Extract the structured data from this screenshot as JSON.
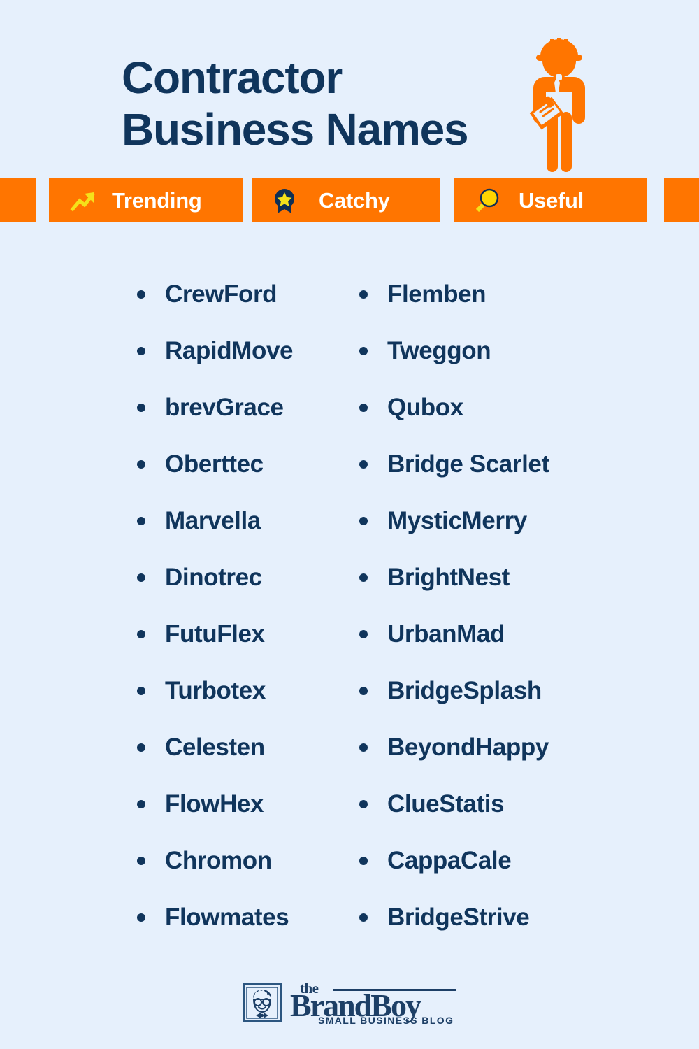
{
  "page": {
    "background_color": "#e6f0fc",
    "accent_color": "#ff7500",
    "navy_color": "#10355c",
    "yellow_color": "#f5e11a"
  },
  "header": {
    "title_line_1": "Contractor",
    "title_line_2": "Business Names",
    "illustration": "contractor-figure-icon"
  },
  "badge_bar": {
    "badges": [
      {
        "label": "Trending",
        "icon": "trending-up-arrow-icon"
      },
      {
        "label": "Catchy",
        "icon": "award-ribbon-star-icon"
      },
      {
        "label": "Useful",
        "icon": "magnifying-glass-icon"
      }
    ]
  },
  "names": {
    "left_column": [
      "CrewFord",
      "RapidMove",
      "brevGrace",
      "Oberttec",
      "Marvella",
      "Dinotrec",
      "FutuFlex",
      "Turbotex",
      "Celesten",
      "FlowHex",
      "Chromon",
      "Flowmates"
    ],
    "right_column": [
      "Flemben",
      "Tweggon",
      "Qubox",
      "Bridge Scarlet",
      "MysticMerry",
      "BrightNest",
      "UrbanMad",
      "BridgeSplash",
      "BeyondHappy",
      "ClueStatis",
      "CappaCale",
      "BridgeStrive"
    ]
  },
  "footer": {
    "logo_mark": "brandboy-face-icon",
    "logo_the": "the",
    "logo_name": "BrandBoy",
    "logo_tagline": "SMALL BUSINESS BLOG"
  }
}
